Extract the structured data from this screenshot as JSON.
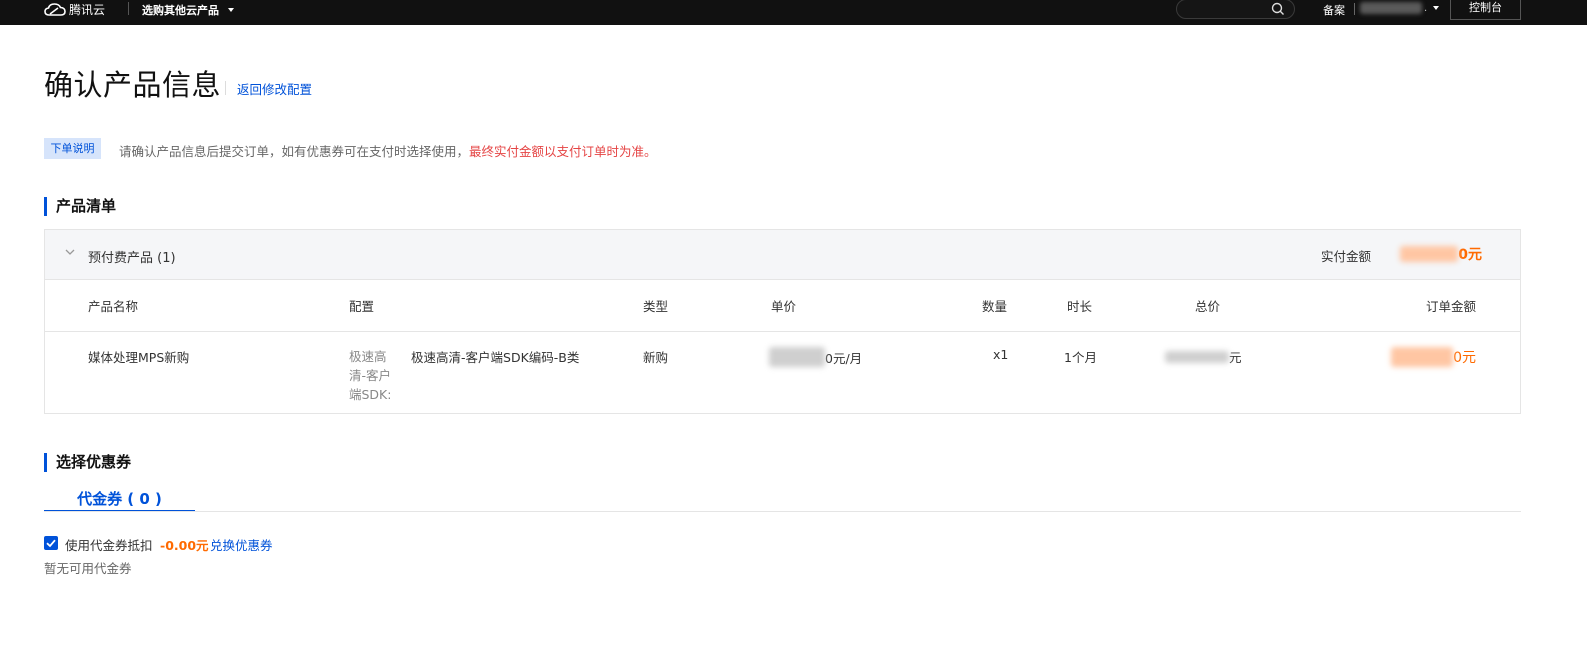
{
  "topbar": {
    "logo_text": "腾讯云",
    "product_menu_label": "选购其他云产品",
    "beian_label": "备案",
    "account_suffix": ".",
    "console_label": "控制台"
  },
  "page": {
    "title": "确认产品信息",
    "back_link": "返回修改配置"
  },
  "notice": {
    "tag": "下单说明",
    "text": "请确认产品信息后提交订单，如有优惠券可在支付时选择使用，",
    "highlight": "最终实付金额以支付订单时为准。"
  },
  "product_list": {
    "section_title": "产品清单",
    "group_label": "预付费产品 (1)",
    "pay_label": "实付金额",
    "pay_amount_visible": "0元",
    "columns": {
      "name": "产品名称",
      "config": "配置",
      "type": "类型",
      "unit_price": "单价",
      "quantity": "数量",
      "duration": "时长",
      "total": "总价",
      "order_amount": "订单金额"
    },
    "rows": [
      {
        "name": "媒体处理MPS新购",
        "config_key": "极速高清-客户端SDK:",
        "config_value": "极速高清-客户端SDK编码-B类",
        "type": "新购",
        "unit_price_visible": "0元/月",
        "quantity": "x1",
        "duration": "1个月",
        "total_visible": "元",
        "order_amount_visible": "0元"
      }
    ]
  },
  "coupon": {
    "section_title": "选择优惠券",
    "tab_label": "代金券 ( 0 )",
    "use_label": "使用代金券抵扣",
    "deduct_amount": "-0.00元",
    "redeem_link": "兑换优惠券",
    "empty_text": "暂无可用代金券",
    "checked": true
  },
  "colors": {
    "accent": "#0052d9",
    "price": "#ff6a00",
    "warning_text": "#e54545",
    "topbar_bg": "#111111"
  }
}
